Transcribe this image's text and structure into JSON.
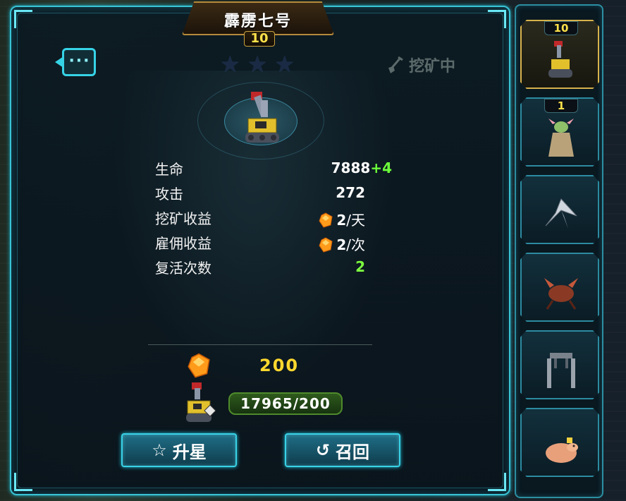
{
  "hero": {
    "name": "霹雳七号",
    "level": "10",
    "stars_total": 3,
    "stars_filled": 0,
    "status": "挖矿中"
  },
  "stats": [
    {
      "label": "生命",
      "value": "7888",
      "bonus": "+4",
      "icon": ""
    },
    {
      "label": "攻击",
      "value": "272",
      "bonus": "",
      "icon": ""
    },
    {
      "label": "挖矿收益",
      "value": "2",
      "unit": "/天",
      "icon": "crystal-icon"
    },
    {
      "label": "雇佣收益",
      "value": "2",
      "unit": "/次",
      "icon": "crystal-icon"
    },
    {
      "label": "复活次数",
      "value": "2",
      "bonus": "",
      "icon": ""
    }
  ],
  "cost": {
    "icon": "crystal-icon",
    "value": "200"
  },
  "shards": {
    "icon": "hero-shard-icon",
    "progress_text": "17965/200"
  },
  "buttons": {
    "upgrade_label": "升星",
    "upgrade_icon": "star-outline-icon",
    "recall_label": "召回",
    "recall_icon": "recall-arrow-icon"
  },
  "sidebar": {
    "slots": [
      {
        "level": "10",
        "icon": "robot-miner-icon",
        "selected": true
      },
      {
        "level": "1",
        "icon": "alien-creature-icon",
        "selected": false
      },
      {
        "level": "",
        "icon": "jet-fighter-icon",
        "selected": false
      },
      {
        "level": "",
        "icon": "insect-beast-icon",
        "selected": false
      },
      {
        "level": "",
        "icon": "mech-walker-icon",
        "selected": false
      },
      {
        "level": "",
        "icon": "hamster-icon",
        "selected": false
      }
    ]
  },
  "colors": {
    "frame_cyan": "#39c4d6",
    "level_yellow": "#ffe14a",
    "bonus_green": "#6dff3b",
    "cost_gold": "#ffd82e",
    "shard_bar_green": "#2e5a1c"
  }
}
